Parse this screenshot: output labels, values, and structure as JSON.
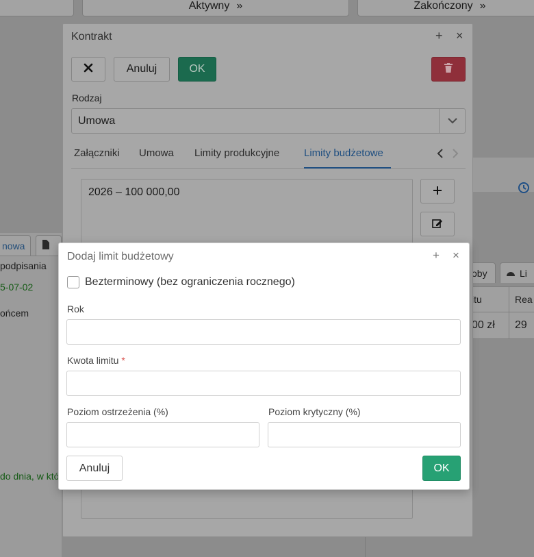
{
  "background": {
    "top_buttons": [
      {
        "label": "Aktywny",
        "icon": "double-chevron-right-icon"
      },
      {
        "label": "Zakończony",
        "icon": "double-chevron-right-icon"
      }
    ],
    "left_tab_label": "nowa",
    "left_fields": {
      "signing_label": "podpisania",
      "signing_date": "5-07-02",
      "end_label": "ońcem",
      "footer_note": "do dnia, w któ"
    },
    "right_tabs": [
      "oby",
      "Li"
    ],
    "right_table": {
      "headers": [
        "itu",
        "Rea"
      ],
      "row": [
        "00 zł",
        "29"
      ]
    }
  },
  "contract_dialog": {
    "title": "Kontrakt",
    "toolbar": {
      "cancel_label": "Anuluj",
      "ok_label": "OK"
    },
    "type_label": "Rodzaj",
    "type_value": "Umowa",
    "tabs": [
      "Załączniki",
      "Umowa",
      "Limity produkcyjne",
      "Limity budżetowe"
    ],
    "active_tab": "Limity budżetowe",
    "limits": [
      "2026 – 100 000,00"
    ]
  },
  "limit_dialog": {
    "title": "Dodaj limit budżetowy",
    "checkbox_label": "Bezterminowy (bez ograniczenia rocznego)",
    "checkbox_checked": false,
    "year_label": "Rok",
    "year_value": "",
    "amount_label": "Kwota limitu",
    "amount_required_mark": "*",
    "amount_value": "",
    "warning_label": "Poziom ostrzeżenia (%)",
    "warning_value": "",
    "critical_label": "Poziom krytyczny (%)",
    "critical_value": "",
    "cancel_label": "Anuluj",
    "ok_label": "OK"
  },
  "colors": {
    "ok_green": "#27a174",
    "delete_red": "#8f2f3a",
    "active_tab_blue": "#1e4e80",
    "required_red": "#d9534f"
  }
}
